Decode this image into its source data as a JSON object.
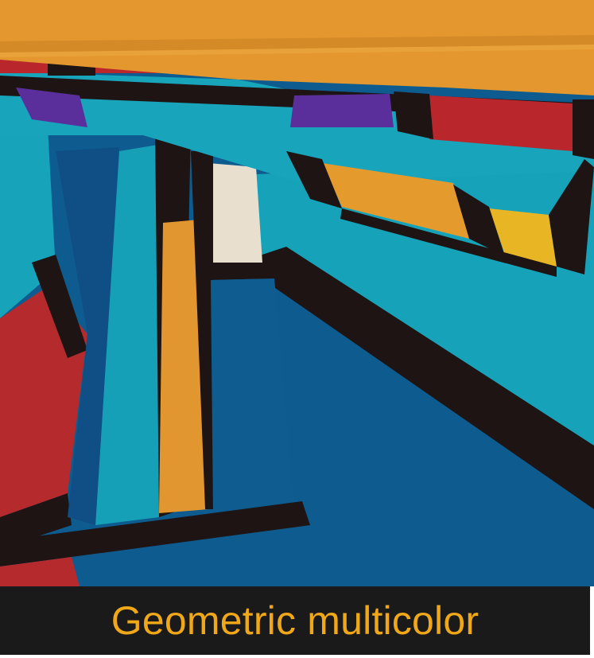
{
  "caption": {
    "text": "Geometric multicolor",
    "color": "#f0a818",
    "background": "#1a1a1a"
  },
  "photo": {
    "subject": "folded geometric multicolor fabric",
    "palette": {
      "orange": "#e2962f",
      "teal": "#13a0b7",
      "deep_blue": "#0e5c8f",
      "black": "#1d1413",
      "red": "#b8262b",
      "purple": "#5a2f9c",
      "cream": "#e8e0d0",
      "yellow": "#e9b423"
    }
  }
}
